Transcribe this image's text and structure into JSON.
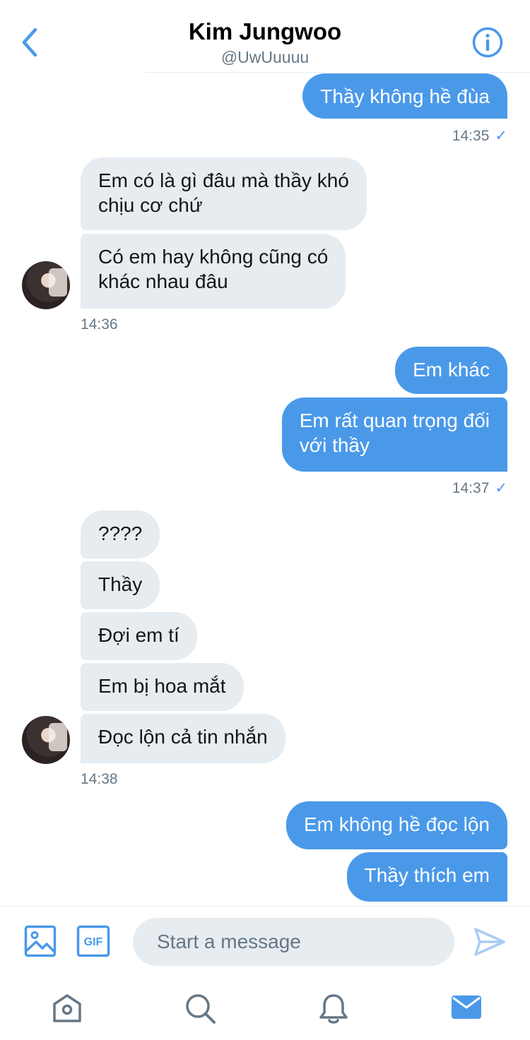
{
  "header": {
    "title": "Kim Jungwoo",
    "handle": "@UwUuuuu",
    "icons": {
      "back": "chevron-left-icon",
      "info": "info-icon"
    }
  },
  "messages": {
    "m1": "Thầy không hề đùa",
    "t1": "14:35",
    "m2_l1": "Em có là gì đâu mà thầy khó",
    "m2_l2": "chịu cơ chứ",
    "m3_l1": "Có em hay không cũng có",
    "m3_l2": "khác nhau đâu",
    "t2": "14:36",
    "m4": "Em khác",
    "m5_l1": "Em rất quan trọng đối",
    "m5_l2": "với thầy",
    "t3": "14:37",
    "m6": "????",
    "m7": "Thầy",
    "m8": "Đợi em tí",
    "m9": "Em bị hoa mắt",
    "m10": "Đọc lộn cả tin nhắn",
    "t4": "14:38",
    "m11": "Em không hề đọc lộn",
    "m12": "Thầy thích em",
    "read_mark": "✓"
  },
  "composer": {
    "placeholder": "Start a message",
    "icons": {
      "image": "image-icon",
      "gif": "gif-icon",
      "send": "send-icon"
    },
    "gif_label": "GIF"
  },
  "tabbar": {
    "items": [
      "home-icon",
      "search-icon",
      "notifications-icon",
      "messages-icon"
    ],
    "active": "messages-icon"
  },
  "colors": {
    "accent": "#4a99e9",
    "incoming_bubble": "#e6ecf0",
    "muted_text": "#657786",
    "tab_icon": "#657786"
  }
}
